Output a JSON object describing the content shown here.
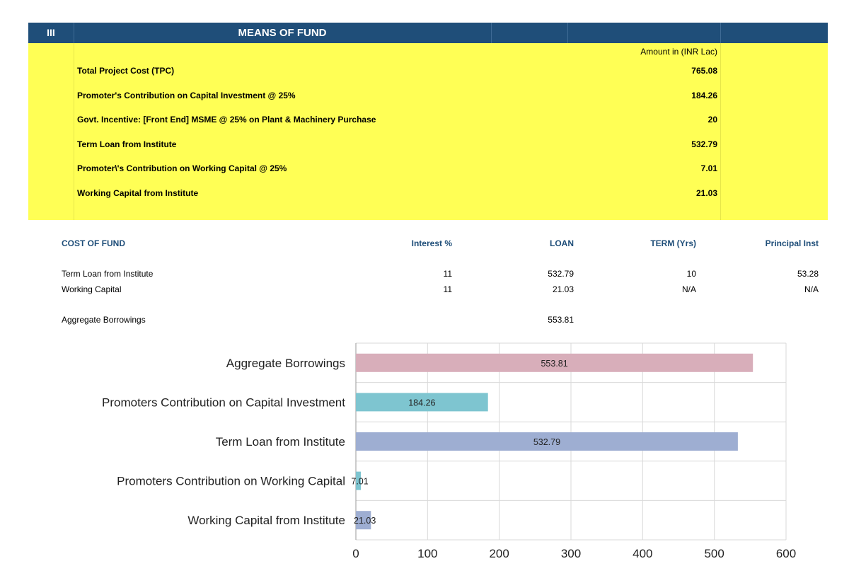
{
  "header": {
    "section_number": "III",
    "title": "MEANS OF FUND"
  },
  "means_of_fund": {
    "amount_caption": "Amount in (INR Lac)",
    "rows": [
      {
        "label": "Total Project Cost (TPC)",
        "value": "765.08"
      },
      {
        "label": "Promoter's Contribution on Capital Investment @ 25%",
        "value": "184.26"
      },
      {
        "label": "Govt. Incentive: [Front End] MSME @ 25% on Plant & Machinery Purchase",
        "value": "20"
      },
      {
        "label": "Term Loan from Institute",
        "value": "532.79"
      },
      {
        "label": "Promoter\\'s Contribution on Working Capital @ 25%",
        "value": "7.01"
      },
      {
        "label": "Working Capital from Institute",
        "value": "21.03"
      }
    ],
    "colors": {
      "header_bg": "#1f4e79",
      "block_bg": "#ffff55"
    }
  },
  "cost_of_fund": {
    "headers": [
      "COST OF FUND",
      "Interest %",
      "LOAN",
      "TERM (Yrs)",
      "Principal Inst"
    ],
    "rows": [
      [
        "Term Loan from Institute",
        "11",
        "532.79",
        "10",
        "53.28"
      ],
      [
        "Working Capital",
        "11",
        "21.03",
        "N/A",
        "N/A"
      ]
    ],
    "aggregate": {
      "label": "Aggregate Borrowings",
      "loan": "553.81"
    }
  },
  "chart_data": {
    "type": "bar",
    "orientation": "horizontal",
    "categories": [
      "Aggregate Borrowings",
      "Promoters Contribution on Capital Investment",
      "Term Loan from Institute",
      "Promoters Contribution on Working Capital",
      "Working Capital from Institute"
    ],
    "values": [
      553.81,
      184.26,
      532.79,
      7.01,
      21.03
    ],
    "data_labels": [
      "553.81",
      "184.26",
      "532.79",
      "7.01",
      "21.03"
    ],
    "colors": [
      "#d8aeba",
      "#7ec5d0",
      "#9eaed2",
      "#7ec5d0",
      "#9eaed2"
    ],
    "xlim": [
      0,
      600
    ],
    "xticks": [
      0,
      100,
      200,
      300,
      400,
      500,
      600
    ],
    "grid": true
  }
}
